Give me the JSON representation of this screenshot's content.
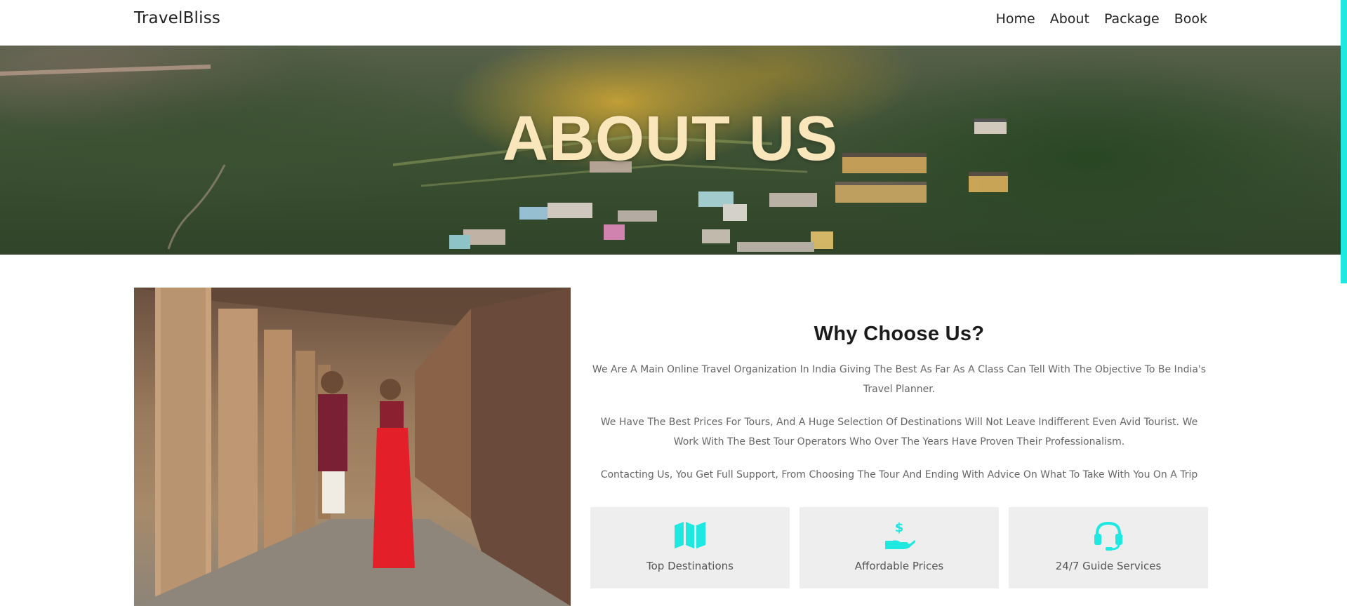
{
  "brand": {
    "name": "TravelBliss",
    "accent_color": "#1ee8e0"
  },
  "nav": {
    "items": [
      {
        "label": "Home"
      },
      {
        "label": "About"
      },
      {
        "label": "Package"
      },
      {
        "label": "Book"
      }
    ]
  },
  "hero": {
    "title": "ABOUT US",
    "title_color": "#fae6bb"
  },
  "about": {
    "title": "Why Choose Us?",
    "paragraphs": [
      "We Are A Main Online Travel Organization In India Giving The Best As Far As A Class Can Tell With The Objective To Be India's Travel Planner.",
      "We Have The Best Prices For Tours, And A Huge Selection Of Destinations Will Not Leave Indifferent Even Avid Tourist. We Work With The Best Tour Operators Who Over The Years Have Proven Their Professionalism.",
      "Contacting Us, You Get Full Support, From Choosing The Tour And Ending With Advice On What To Take With You On A Trip"
    ]
  },
  "features": [
    {
      "label": "Top Destinations",
      "icon": "map-icon"
    },
    {
      "label": "Affordable Prices",
      "icon": "hand-dollar-icon"
    },
    {
      "label": "24/7 Guide Services",
      "icon": "headset-icon"
    }
  ]
}
